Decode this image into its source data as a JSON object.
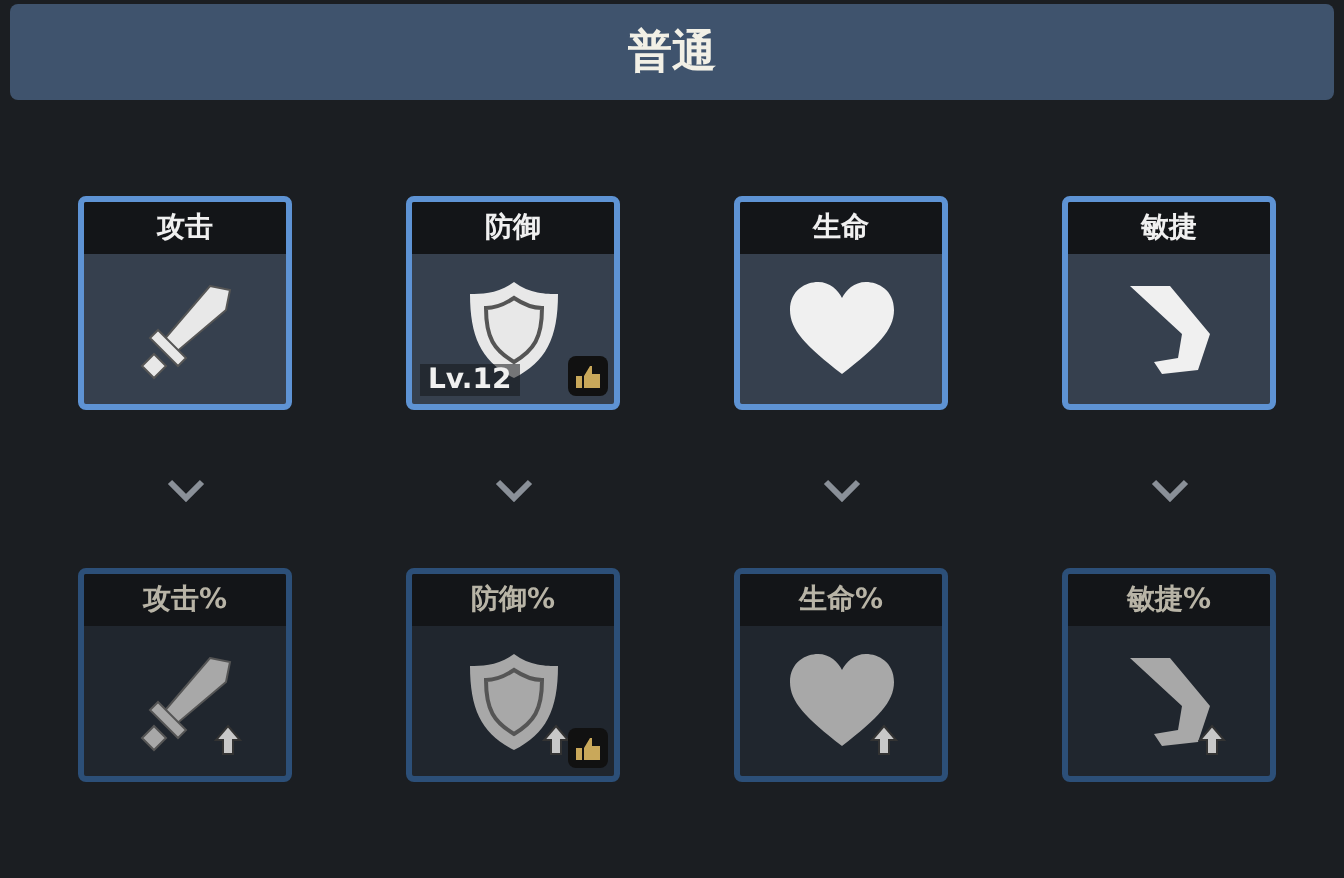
{
  "title": "普通",
  "rows": [
    {
      "skills": [
        {
          "label": "攻击",
          "kind": "sword",
          "active": true,
          "boosted": false,
          "recommended": false
        },
        {
          "label": "防御",
          "kind": "shield",
          "active": true,
          "boosted": false,
          "recommended": true,
          "level_text": "Lv.12"
        },
        {
          "label": "生命",
          "kind": "heart",
          "active": true,
          "boosted": false,
          "recommended": false
        },
        {
          "label": "敏捷",
          "kind": "boot",
          "active": true,
          "boosted": false,
          "recommended": false
        }
      ]
    },
    {
      "skills": [
        {
          "label": "攻击%",
          "kind": "sword",
          "active": false,
          "boosted": true,
          "recommended": false
        },
        {
          "label": "防御%",
          "kind": "shield",
          "active": false,
          "boosted": true,
          "recommended": true
        },
        {
          "label": "生命%",
          "kind": "heart",
          "active": false,
          "boosted": true,
          "recommended": false
        },
        {
          "label": "敏捷%",
          "kind": "boot",
          "active": false,
          "boosted": true,
          "recommended": false
        }
      ]
    }
  ]
}
